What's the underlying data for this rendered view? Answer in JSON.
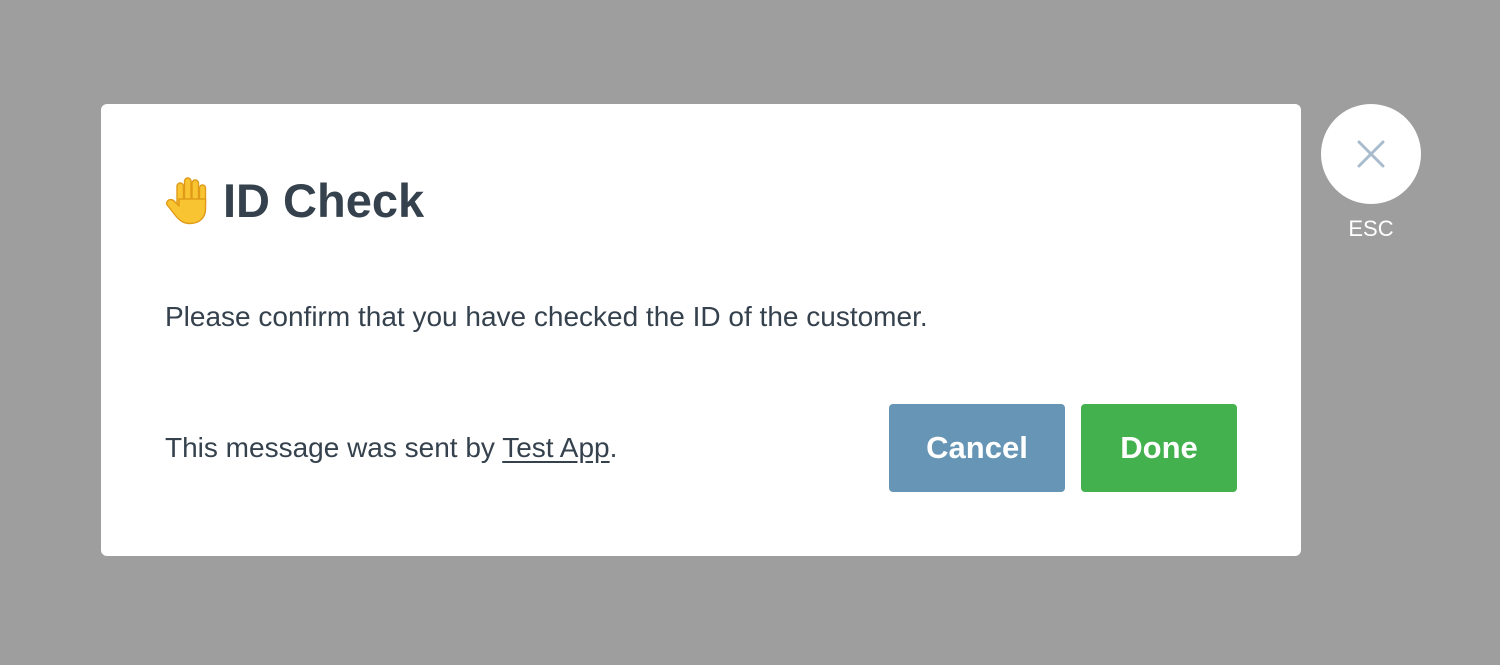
{
  "dialog": {
    "title": "ID Check",
    "title_icon": "raised-hand-icon",
    "message": "Please confirm that you have checked the ID of the customer.",
    "footer": {
      "prefix": "This message was sent by ",
      "app_link": "Test App",
      "suffix": "."
    },
    "buttons": {
      "cancel": "Cancel",
      "done": "Done"
    }
  },
  "close": {
    "icon": "close-icon",
    "label": "ESC"
  },
  "colors": {
    "overlay": "#9d9e9d",
    "text": "#35424e",
    "cancel": "#6795b5",
    "done": "#43b14d",
    "close_icon": "#a9bccd"
  }
}
